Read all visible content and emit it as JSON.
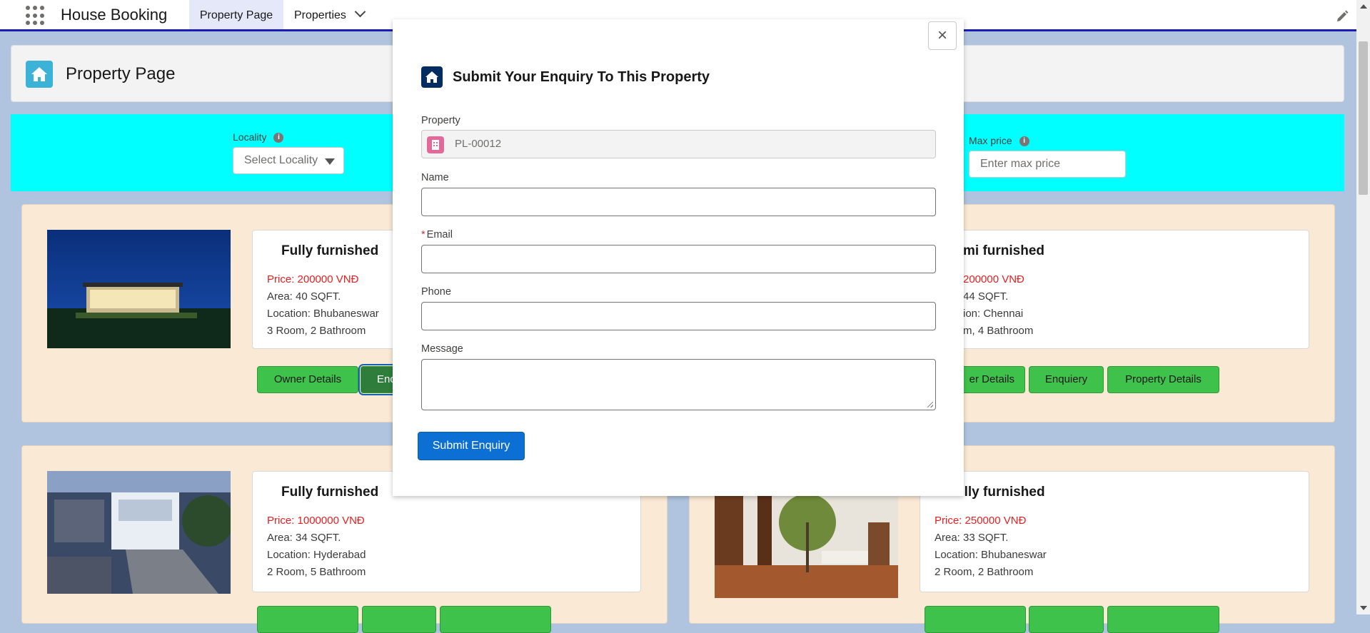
{
  "nav": {
    "app_name": "House Booking",
    "tabs": [
      {
        "label": "Property Page"
      },
      {
        "label": "Properties"
      }
    ]
  },
  "page_header": {
    "title": "Property Page"
  },
  "filters": {
    "locality_label": "Locality",
    "locality_value": "Select Locality",
    "max_price_label": "Max price",
    "max_price_placeholder": "Enter max price"
  },
  "properties": [
    {
      "title": "Fully furnished",
      "price": "Price: 200000 VNĐ",
      "area": "Area: 40 SQFT.",
      "location": "Location: Bhubaneswar",
      "rooms": "3 Room, 2 Bathroom"
    },
    {
      "title": "mi furnished",
      "price": "200000 VNĐ",
      "area": "44 SQFT.",
      "location": "ion: Chennai",
      "rooms": "m, 4 Bathroom"
    },
    {
      "title": "Fully furnished",
      "price": "Price: 1000000 VNĐ",
      "area": "Area: 34 SQFT.",
      "location": "Location: Hyderabad",
      "rooms": "2 Room, 5 Bathroom"
    },
    {
      "title": "ully furnished",
      "price": "Price: 250000 VNĐ",
      "area": "Area: 33 SQFT.",
      "location": "Location: Bhubaneswar",
      "rooms": "2 Room, 2 Bathroom"
    }
  ],
  "buttons": {
    "owner_details": "Owner Details",
    "enquiry_partial": "Enc",
    "owner_details_partial": "er Details",
    "enquiry": "Enquiery",
    "property_details": "Property Details"
  },
  "modal": {
    "close": "×",
    "title": "Submit Your Enquiry To This Property",
    "property_label": "Property",
    "property_value": "PL-00012",
    "name_label": "Name",
    "email_required": "*",
    "email_label": "Email",
    "phone_label": "Phone",
    "message_label": "Message",
    "submit_label": "Submit Enquiry"
  },
  "colors": {
    "nav_accent": "#1b1bb5",
    "filter_band": "#00ffff",
    "panel_bg": "#fae9d4",
    "button_green": "#3fc24c",
    "price_red": "#e52020",
    "submit_blue": "#0b6fd3"
  },
  "icons": [
    "app-launcher-icon",
    "chevron-down-icon",
    "edit-pencil-icon",
    "home-icon",
    "info-icon",
    "close-icon",
    "building-icon"
  ]
}
